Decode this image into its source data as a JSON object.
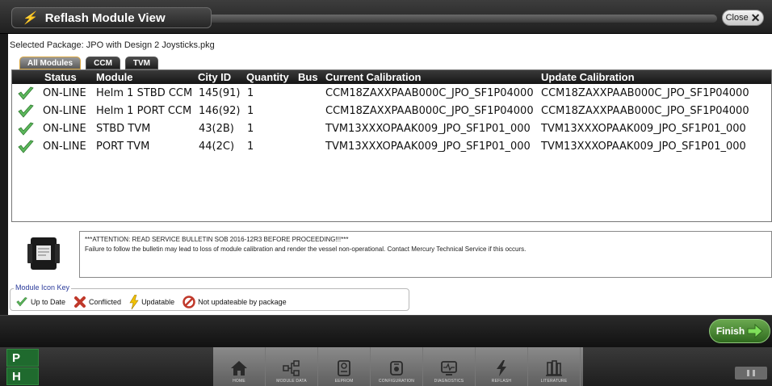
{
  "window": {
    "title": "Reflash Module View",
    "close_label": "Close"
  },
  "package": {
    "label": "Selected Package: JPO with Design 2 Joysticks.pkg"
  },
  "tabs": [
    {
      "label": "All Modules",
      "active": true
    },
    {
      "label": "CCM",
      "active": false
    },
    {
      "label": "TVM",
      "active": false
    }
  ],
  "table": {
    "headers": [
      "Status",
      "Module",
      "City ID",
      "Quantity",
      "Bus",
      "Current Calibration",
      "Update Calibration"
    ],
    "rows": [
      {
        "icon": "check-icon",
        "status": "ON-LINE",
        "module": "Helm 1 STBD CCM",
        "city_id": "145(91)",
        "quantity": "1",
        "bus": "",
        "current": "CCM18ZAXXPAAB000C_JPO_SF1P04000",
        "update": "CCM18ZAXXPAAB000C_JPO_SF1P04000"
      },
      {
        "icon": "check-icon",
        "status": "ON-LINE",
        "module": "Helm 1 PORT CCM",
        "city_id": "146(92)",
        "quantity": "1",
        "bus": "",
        "current": "CCM18ZAXXPAAB000C_JPO_SF1P04000",
        "update": "CCM18ZAXXPAAB000C_JPO_SF1P04000"
      },
      {
        "icon": "check-icon",
        "status": "ON-LINE",
        "module": "STBD TVM",
        "city_id": "43(2B)",
        "quantity": "1",
        "bus": "",
        "current": "TVM13XXXOPAAK009_JPO_SF1P01_000",
        "update": "TVM13XXXOPAAK009_JPO_SF1P01_000"
      },
      {
        "icon": "check-icon",
        "status": "ON-LINE",
        "module": "PORT TVM",
        "city_id": "44(2C)",
        "quantity": "1",
        "bus": "",
        "current": "TVM13XXXOPAAK009_JPO_SF1P01_000",
        "update": "TVM13XXXOPAAK009_JPO_SF1P01_000"
      }
    ]
  },
  "attention": {
    "line1": "***ATTENTION: READ SERVICE BULLETIN SOB 2016-12R3 BEFORE PROCEEDING!!!***",
    "line2": "Failure to follow the bulletin may lead to loss of module calibration and render the vessel non-operational. Contact Mercury Technical Service if this occurs."
  },
  "icon_key": {
    "title": "Module Icon Key",
    "items": [
      {
        "icon": "check-icon",
        "label": "Up to Date"
      },
      {
        "icon": "conflicted-icon",
        "label": "Conflicted"
      },
      {
        "icon": "lightning-icon",
        "label": "Updatable"
      },
      {
        "icon": "no-entry-icon",
        "label": "Not updateable by package"
      }
    ]
  },
  "footer": {
    "finish_label": "Finish"
  },
  "side_buttons": {
    "p": "P",
    "h": "H"
  },
  "nav": [
    {
      "icon": "home-icon",
      "label": "HOME"
    },
    {
      "icon": "module-data-icon",
      "label": "MODULE DATA"
    },
    {
      "icon": "eeprom-icon",
      "label": "EEPROM"
    },
    {
      "icon": "configuration-icon",
      "label": "CONFIGURATION"
    },
    {
      "icon": "diagnostics-icon",
      "label": "DIAGNOSTICS"
    },
    {
      "icon": "reflash-icon",
      "label": "REFLASH"
    },
    {
      "icon": "literature-icon",
      "label": "LITERATURE"
    }
  ],
  "colors": {
    "accent_green": "#3f8f2e",
    "check_green": "#5cb85c",
    "warning_red": "#c0392b",
    "lightning_yellow": "#f2c200",
    "key_title_blue": "#2a3a9a"
  }
}
